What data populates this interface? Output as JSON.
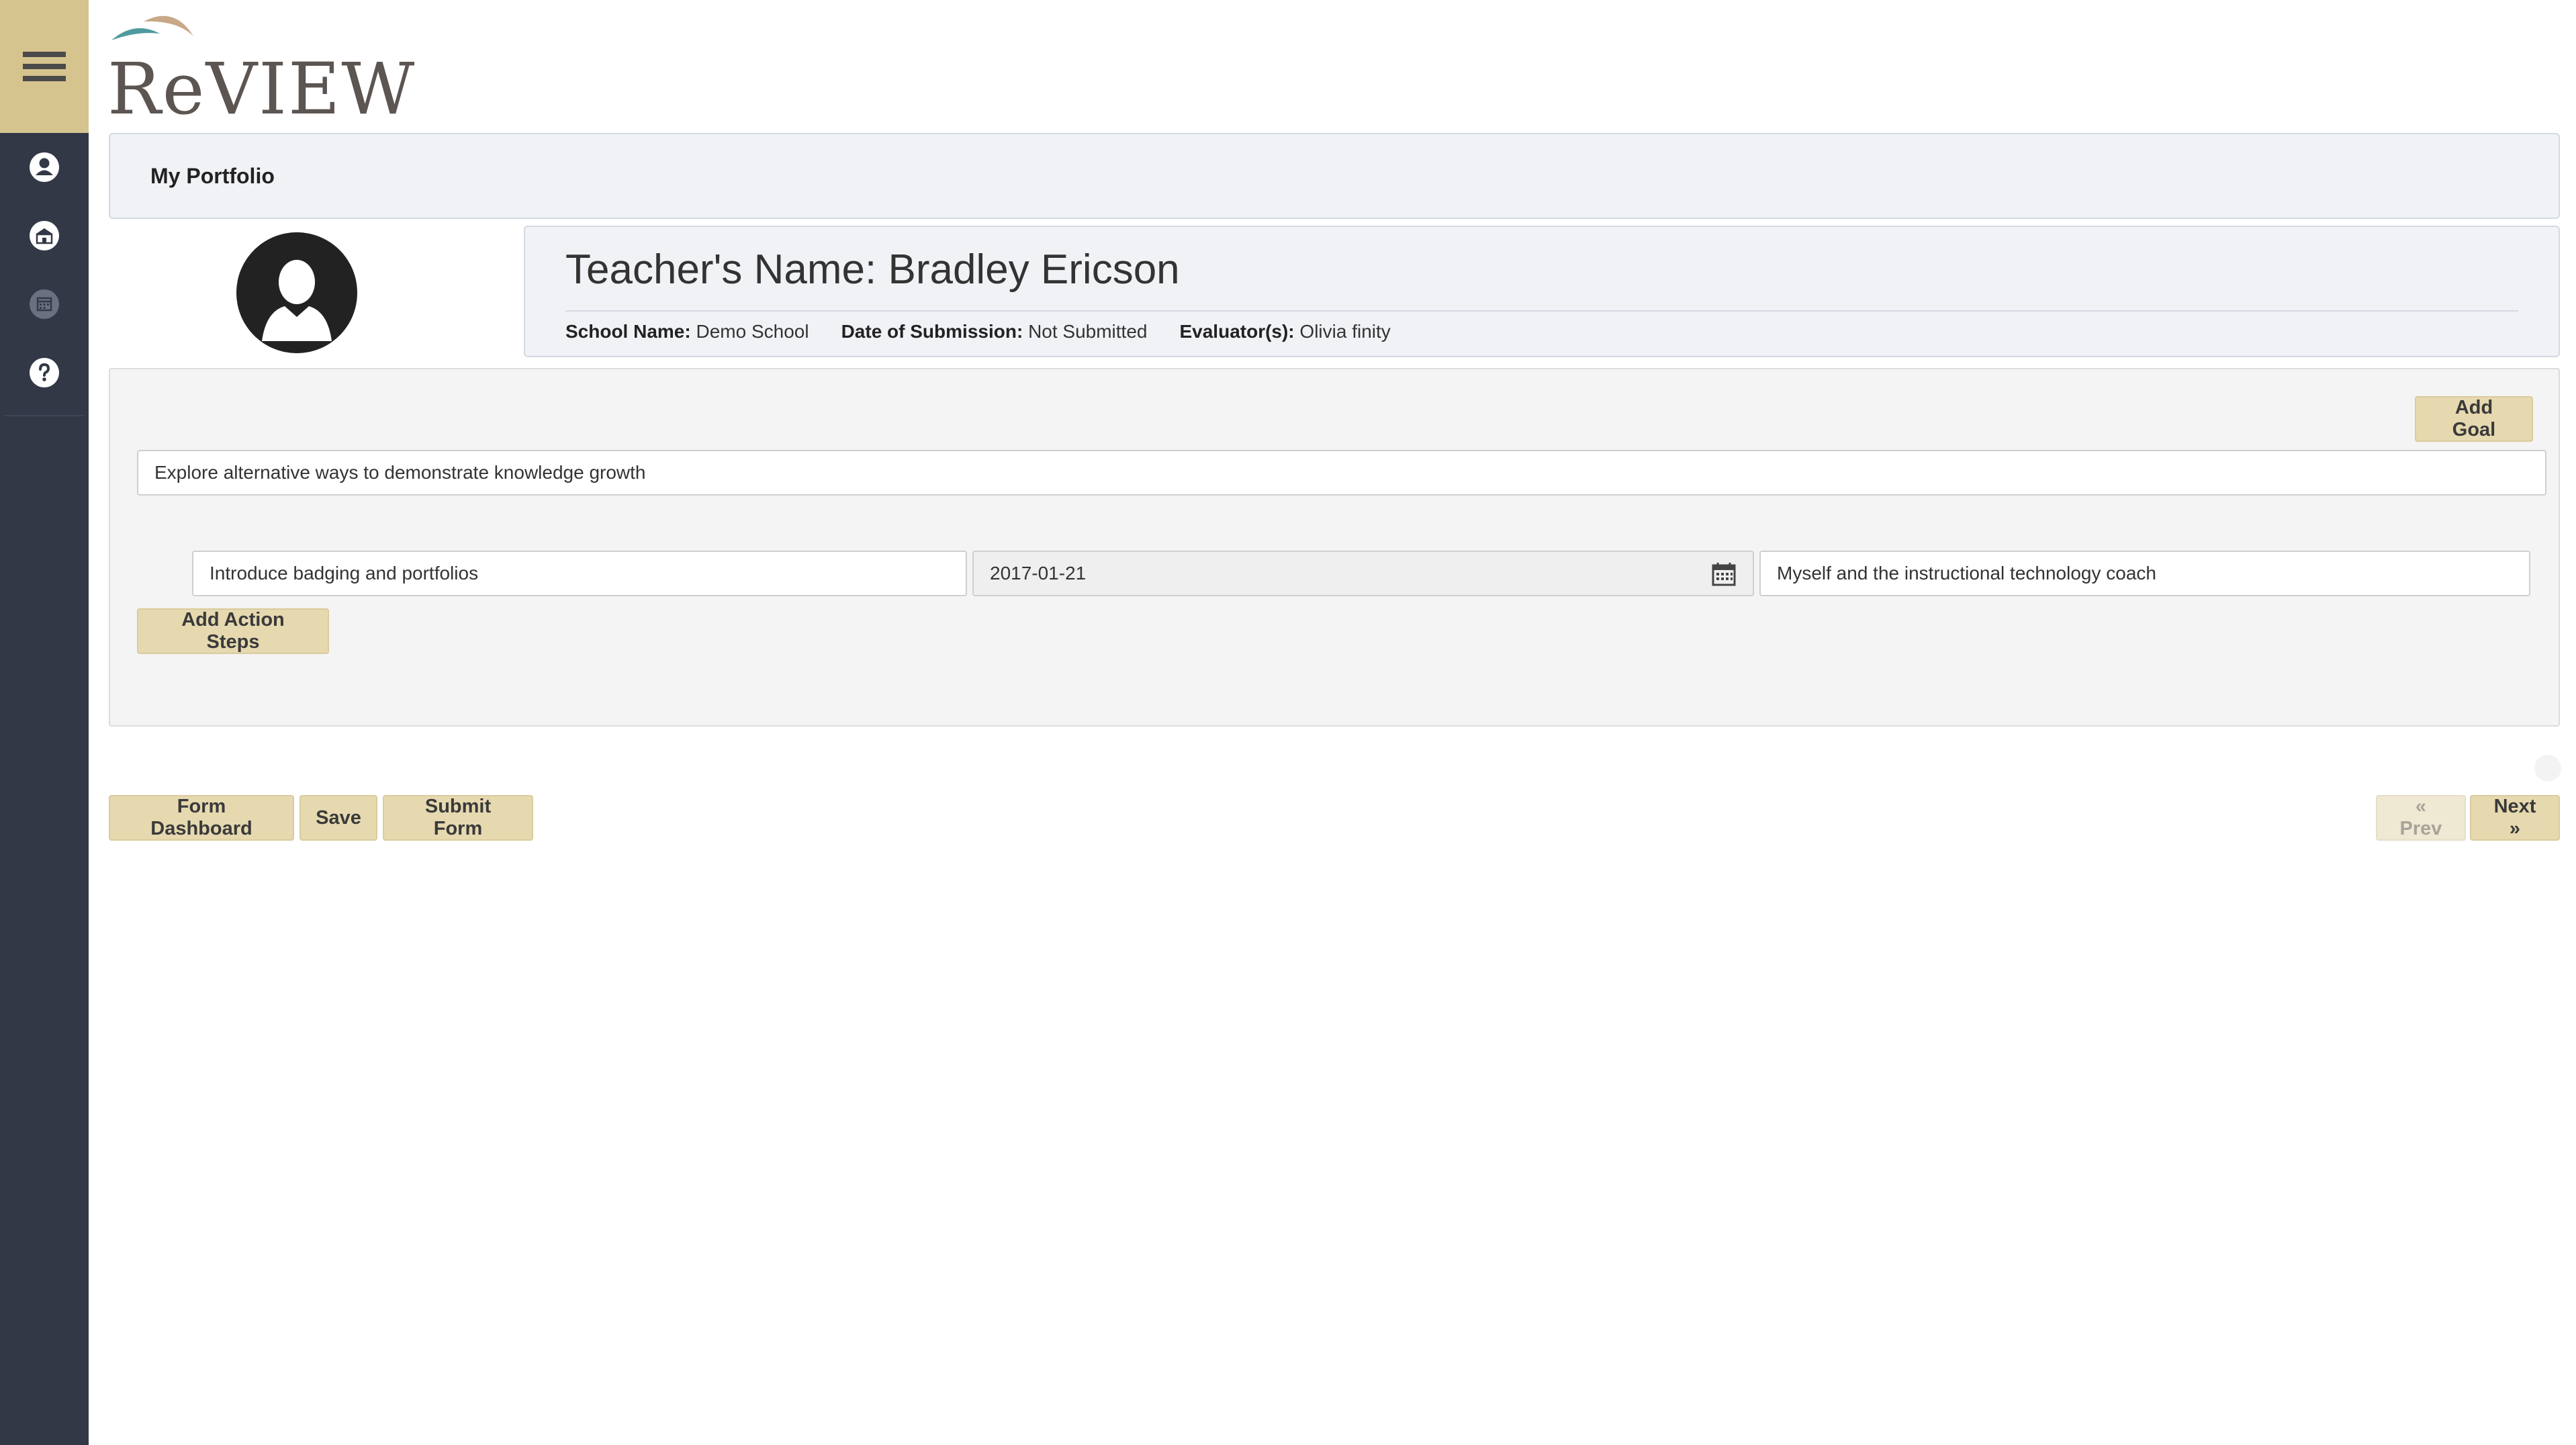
{
  "app": {
    "logo_text": "ReVIEW"
  },
  "sidebar": {
    "icons": [
      {
        "name": "user-icon"
      },
      {
        "name": "building-icon"
      },
      {
        "name": "calendar-icon"
      },
      {
        "name": "help-icon"
      }
    ]
  },
  "header": {
    "title": "My Portfolio"
  },
  "teacher": {
    "name_line": "Teacher's Name: Bradley Ericson",
    "school_label": "School Name:",
    "school_value": "Demo School",
    "date_label": "Date of Submission:",
    "date_value": "Not Submitted",
    "evaluator_label": "Evaluator(s):",
    "evaluator_value": "Olivia finity"
  },
  "goal": {
    "add_goal_label": "Add Goal",
    "goal_text": "Explore alternative ways to demonstrate knowledge growth",
    "action_step": {
      "description": "Introduce badging and portfolios",
      "date": "2017-01-21",
      "responsible": "Myself and the instructional technology coach"
    },
    "add_action_steps_label": "Add Action Steps"
  },
  "footer": {
    "form_dashboard_label": "Form Dashboard",
    "save_label": "Save",
    "submit_label": "Submit Form",
    "prev_label": "« Prev",
    "next_label": "Next »"
  },
  "colors": {
    "sidebar": "#323846",
    "accent": "#d6c48e",
    "button": "#e6d9b0",
    "panel": "#f0f2f6"
  }
}
